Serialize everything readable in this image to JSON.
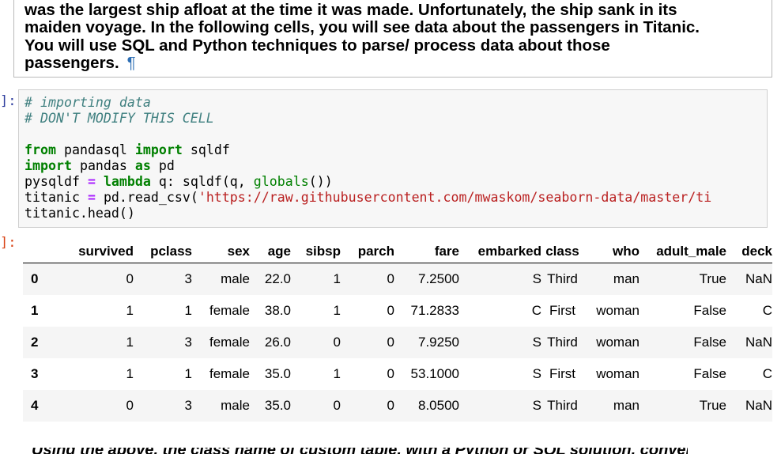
{
  "markdown": {
    "lines": [
      "was the largest ship afloat at the time it was made. Unfortunately, the ship sank in its",
      "maiden voyage. In the following cells, you will see data about the passengers in Titanic.",
      "You will use SQL and Python techniques to parse/ process data about those",
      "passengers."
    ],
    "pilcrow": "¶"
  },
  "prompts": {
    "input": "]:",
    "output": "]:"
  },
  "code": {
    "comment1": "# importing data",
    "comment2": "# DON'T MODIFY THIS CELL",
    "kw_from": "from",
    "module_pandasql": "pandasql",
    "kw_import": "import",
    "name_sqldf": "sqldf",
    "module_pandas": "pandas",
    "kw_as": "as",
    "alias_pd": "pd",
    "var_pysqldf": "pysqldf",
    "op_eq": "=",
    "kw_lambda": "lambda",
    "lambda_arg": "q: sqldf(q, ",
    "builtin_globals": "globals",
    "call_parens": "())",
    "var_titanic": "titanic",
    "read_csv": "pd.read_csv(",
    "url": "'https://raw.githubusercontent.com/mwaskom/seaborn-data/master/ti",
    "head_call": "titanic.head()"
  },
  "dataframe": {
    "columns": [
      "survived",
      "pclass",
      "sex",
      "age",
      "sibsp",
      "parch",
      "fare",
      "embarked",
      "class",
      "who",
      "adult_male",
      "deck"
    ],
    "rows": [
      {
        "index": "0",
        "cells": [
          "0",
          "3",
          "male",
          "22.0",
          "1",
          "0",
          "7.2500",
          "S",
          "Third",
          "man",
          "True",
          "NaN"
        ]
      },
      {
        "index": "1",
        "cells": [
          "1",
          "1",
          "female",
          "38.0",
          "1",
          "0",
          "71.2833",
          "C",
          "First",
          "woman",
          "False",
          "C"
        ]
      },
      {
        "index": "2",
        "cells": [
          "1",
          "3",
          "female",
          "26.0",
          "0",
          "0",
          "7.9250",
          "S",
          "Third",
          "woman",
          "False",
          "NaN"
        ]
      },
      {
        "index": "3",
        "cells": [
          "1",
          "1",
          "female",
          "35.0",
          "1",
          "0",
          "53.1000",
          "S",
          "First",
          "woman",
          "False",
          "C"
        ]
      },
      {
        "index": "4",
        "cells": [
          "0",
          "3",
          "male",
          "35.0",
          "0",
          "0",
          "8.0500",
          "S",
          "Third",
          "man",
          "True",
          "NaN"
        ]
      }
    ]
  },
  "bottom_cut_text": "Using the above, the class name of custom table, with a Python or SQL solution, convert fit"
}
